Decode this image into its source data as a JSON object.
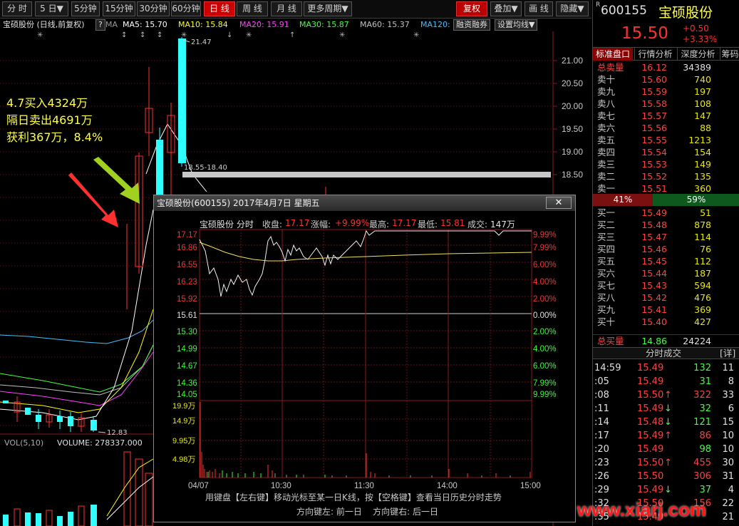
{
  "toolbar": {
    "items": [
      "分 时",
      "5 日▼",
      "5分钟",
      "15分钟",
      "30分钟",
      "60分钟",
      "日 线",
      "周 线",
      "月 线",
      "更多周期▼",
      "复权",
      "叠加▼",
      "画 线",
      "隐藏▼"
    ],
    "active": "日 线",
    "red_item": "复权"
  },
  "ma": {
    "title": "宝硕股份 (日线,前复权)",
    "q": "?",
    "ma": "MA",
    "ma5": "MA5: 15.70",
    "ma10": "MA10: 15.84",
    "ma20": "MA20: 15.91",
    "ma30": "MA30: 15.87",
    "ma60": "MA60: 15.37",
    "ma120": "MA120:",
    "btn1": "融资融券",
    "btn2": "设置均线▼"
  },
  "chart": {
    "price_ticks": [
      "21.00",
      "20.50",
      "20.00",
      "19.50",
      "19.00",
      "18.50"
    ],
    "high_label": "21.47",
    "range_label": "18.55-18.40",
    "low_label": "12.83"
  },
  "annotation": {
    "line1": "4.7买入4324万",
    "line2": "隔日卖出4691万",
    "line3": "获利367万，8.4%"
  },
  "vol": {
    "label": "VOL(5,10)",
    "value": "VOLUME: 278337.000"
  },
  "stock": {
    "r": "R",
    "code": "600155",
    "name": "宝硕股份",
    "price": "15.50",
    "change": "+0.50",
    "pct": "+3.33%"
  },
  "tabs": [
    "标准盘口",
    "行情分析",
    "深度分析",
    "筹码"
  ],
  "sell_total": {
    "label": "总卖量",
    "price": "16.12",
    "vol": "34389"
  },
  "asks": [
    [
      "卖十",
      "15.60",
      "740"
    ],
    [
      "卖九",
      "15.59",
      "197"
    ],
    [
      "卖八",
      "15.58",
      "108"
    ],
    [
      "卖七",
      "15.57",
      "147"
    ],
    [
      "卖六",
      "15.56",
      "88"
    ],
    [
      "卖五",
      "15.55",
      "1213"
    ],
    [
      "卖四",
      "15.54",
      "154"
    ],
    [
      "卖三",
      "15.53",
      "149"
    ],
    [
      "卖二",
      "15.52",
      "135"
    ],
    [
      "卖一",
      "15.51",
      "360"
    ]
  ],
  "ratio": {
    "sell": "41%",
    "buy": "59%"
  },
  "bids": [
    [
      "买一",
      "15.49",
      "51"
    ],
    [
      "买二",
      "15.48",
      "878"
    ],
    [
      "买三",
      "15.47",
      "114"
    ],
    [
      "买四",
      "15.46",
      "76"
    ],
    [
      "买五",
      "15.45",
      "112"
    ],
    [
      "买六",
      "15.44",
      "187"
    ],
    [
      "买七",
      "15.43",
      "594"
    ],
    [
      "买八",
      "15.42",
      "476"
    ],
    [
      "买九",
      "15.41",
      "369"
    ],
    [
      "买十",
      "15.40",
      "427"
    ]
  ],
  "buy_total": {
    "label": "总买量",
    "price": "14.86",
    "vol": "24224"
  },
  "ticks_header": {
    "title": "分时成交",
    "detail": "[详]"
  },
  "ticks": [
    [
      "14:59",
      "15.49",
      "",
      "132",
      "11",
      "g"
    ],
    [
      ":05",
      "15.49",
      "",
      "31",
      "8",
      "g"
    ],
    [
      ":08",
      "15.50",
      "↑",
      "322",
      "33",
      "r"
    ],
    [
      ":11",
      "15.49",
      "↓",
      "32",
      "6",
      "g"
    ],
    [
      ":14",
      "15.48",
      "↓",
      "121",
      "15",
      "g"
    ],
    [
      ":17",
      "15.49",
      "↑",
      "86",
      "10",
      "r"
    ],
    [
      ":20",
      "15.49",
      "",
      "98",
      "10",
      "g"
    ],
    [
      ":23",
      "15.50",
      "↑",
      "455",
      "30",
      "r"
    ],
    [
      ":26",
      "15.50",
      "",
      "306",
      "31",
      "r"
    ],
    [
      ":29",
      "15.49",
      "↓",
      "37",
      "4",
      "g"
    ],
    [
      ":32",
      "15.50",
      "",
      "156",
      "22",
      "r"
    ],
    [
      ":35",
      "15.49",
      "",
      "",
      "21",
      "g"
    ]
  ],
  "popup": {
    "title": "宝硕股份(600155) 2017年4月7日 星期五",
    "close": "✕",
    "info_name": "宝硕股份 分时",
    "info_close_label": "收盘:",
    "info_close": "17.17",
    "info_chg_label": "涨幅:",
    "info_chg": "+9.99%",
    "info_high_label": "最高:",
    "info_high": "17.17",
    "info_low_label": "最低:",
    "info_low": "15.81",
    "info_vol_label": "成交:",
    "info_vol": "147万",
    "left_prices": [
      "17.17",
      "16.86",
      "16.55",
      "16.23",
      "15.92",
      "15.61",
      "15.30",
      "14.99",
      "14.67",
      "14.36",
      "14.05"
    ],
    "right_pcts": [
      "9.99%",
      "7.99%",
      "6.00%",
      "4.00%",
      "2.00%",
      "0.00%",
      "2.00%",
      "4.00%",
      "6.00%",
      "7.99%",
      "9.99%"
    ],
    "vol_ticks": [
      "19.9万",
      "14.9万",
      "9.95万",
      "4.98万"
    ],
    "time_ticks": [
      "04/07",
      "10:30",
      "11:30",
      "14:00",
      "15:00"
    ],
    "hint1": "用键盘【左右键】移动光标至某一日K线，按【空格键】查看当日历史分时走势",
    "hint2": "方向键左: 前一日    方向键右: 后一日"
  },
  "watermark": "www.xiarj.com",
  "colors": {
    "up": "#ff3030",
    "down": "#30ffff",
    "ma5": "#ffffff",
    "ma10": "#ffff00",
    "ma20": "#ff40ff",
    "ma30": "#40ff40",
    "ma60": "#c0c0c0",
    "ma120": "#40c0ff"
  }
}
